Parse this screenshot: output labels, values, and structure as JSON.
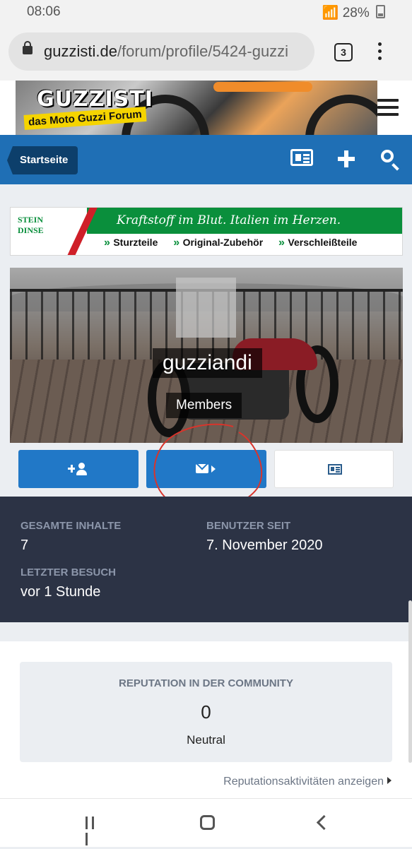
{
  "status_bar": {
    "time": "08:06",
    "battery": "28%"
  },
  "browser": {
    "url_domain": "guzzisti.de",
    "url_path": "/forum/profile/5424-guzzi",
    "tab_count": "3"
  },
  "site": {
    "logo_title": "GUZZISTI",
    "logo_subtitle": "das Moto Guzzi Forum"
  },
  "nav": {
    "home_label": "Startseite"
  },
  "ad": {
    "logo": "STEIN DINSE",
    "slogan": "Kraftstoff im Blut. Italien im Herzen.",
    "items": [
      "Sturzteile",
      "Original-Zubehör",
      "Verschleißteile"
    ]
  },
  "profile": {
    "username": "guzziandi",
    "group": "Members",
    "stats": [
      {
        "label": "Gesamte Inhalte",
        "value": "7"
      },
      {
        "label": "Benutzer seit",
        "value": "7. November 2020"
      },
      {
        "label": "Letzter Besuch",
        "value": "vor 1 Stunde"
      }
    ]
  },
  "reputation": {
    "title": "REPUTATION IN DER COMMUNITY",
    "value": "0",
    "level": "Neutral",
    "link": "Reputationsaktivitäten anzeigen"
  },
  "colors": {
    "nav_blue": "#1f6fb5",
    "button_blue": "#2178c7",
    "stats_bg": "#2c3345",
    "annotation_red": "#d9342b"
  },
  "icons": [
    "lock-icon",
    "hamburger-icon",
    "news-icon",
    "plus-icon",
    "search-icon",
    "follow-icon",
    "mail-icon",
    "content-icon",
    "back-icon",
    "home-icon",
    "recent-apps-icon"
  ]
}
